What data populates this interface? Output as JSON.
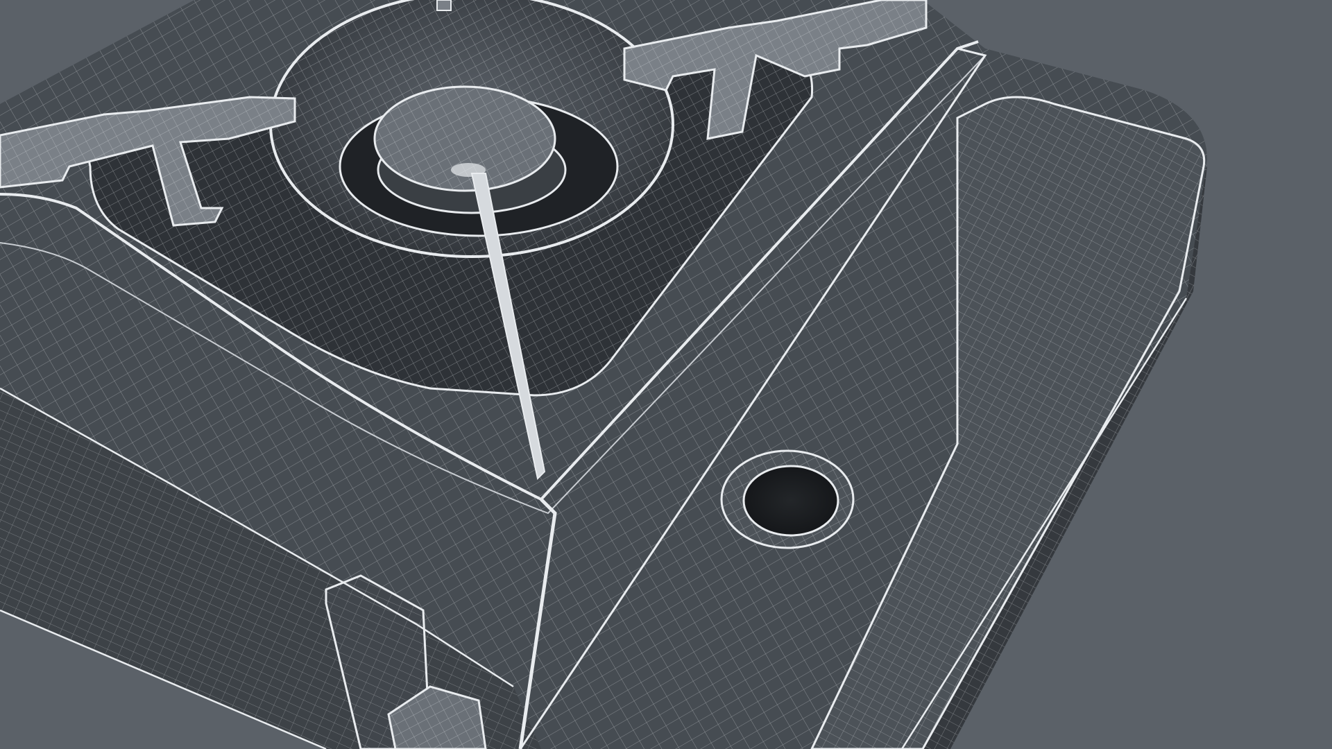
{
  "scene": {
    "subject": "portable-gas-stove-wireframe",
    "colors": {
      "background": "#5b6168",
      "body_fill": "#3d4247",
      "body_fill_dark": "#2e3237",
      "body_fill_light": "#4a5056",
      "recess_fill": "#2a2e33",
      "hole_fill": "#1d2024",
      "wire_line": "#e9ecef",
      "wire_line_soft": "#c9cdd2"
    }
  }
}
